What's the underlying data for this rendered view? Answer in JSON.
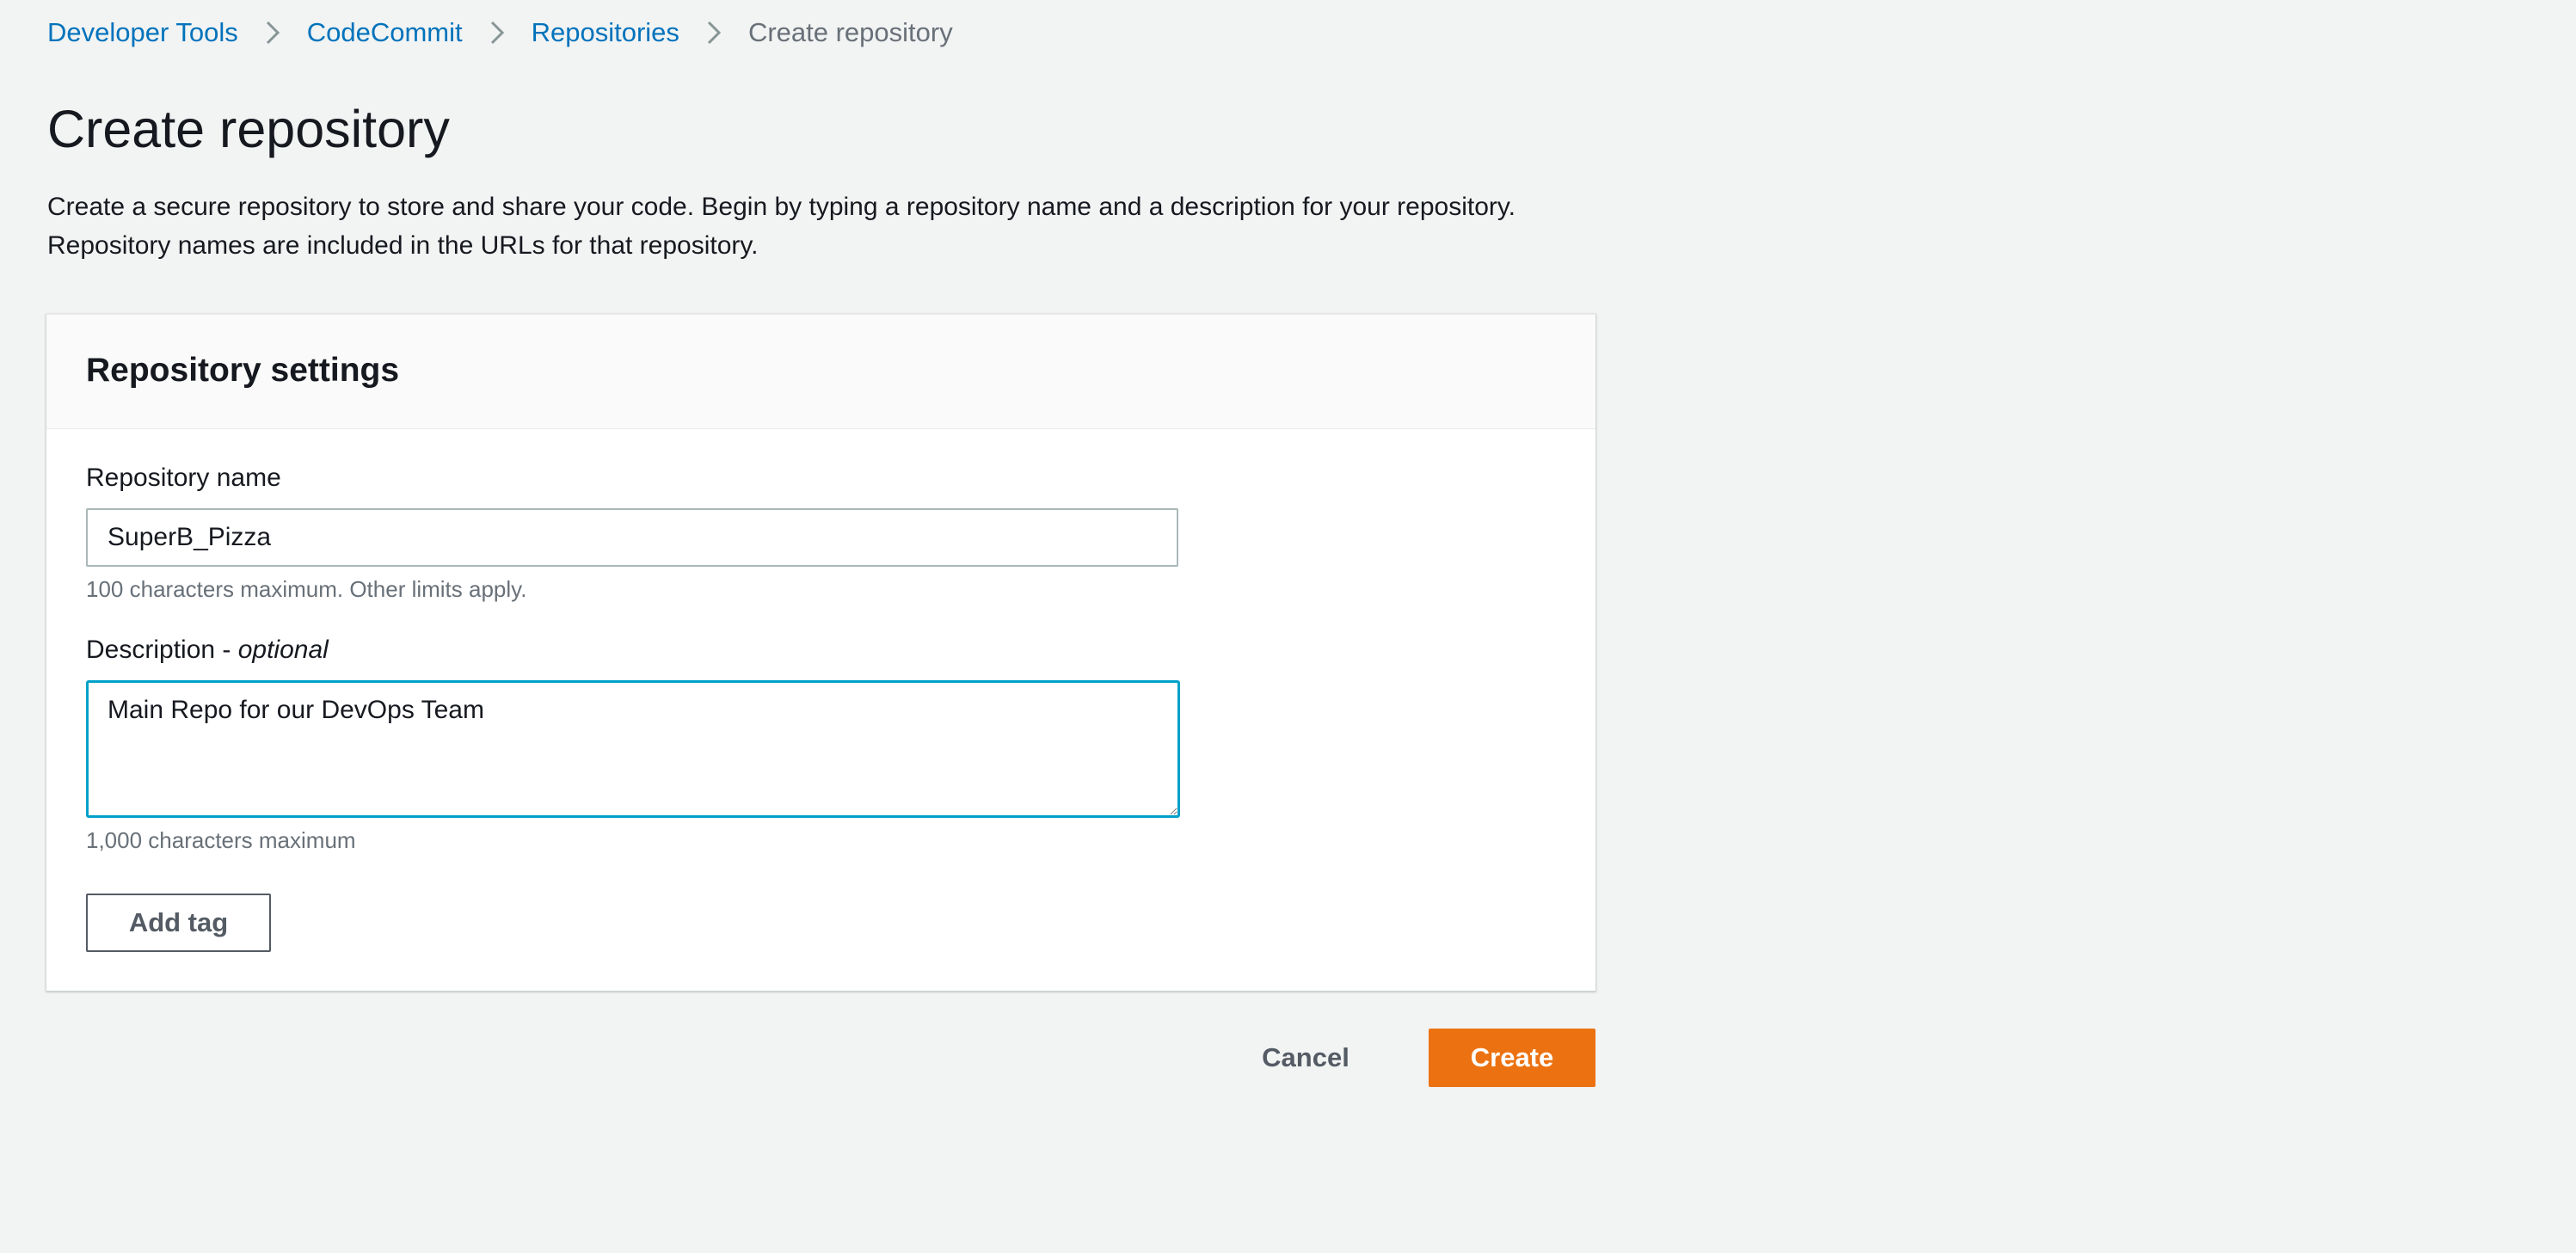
{
  "breadcrumb": {
    "items": [
      {
        "label": "Developer Tools"
      },
      {
        "label": "CodeCommit"
      },
      {
        "label": "Repositories"
      },
      {
        "label": "Create repository"
      }
    ],
    "separator_icon": "chevron-right-icon"
  },
  "page": {
    "title": "Create repository",
    "description": "Create a secure repository to store and share your code. Begin by typing a repository name and a description for your repository. Repository names are included in the URLs for that repository."
  },
  "settings": {
    "title": "Repository settings",
    "name": {
      "label": "Repository name",
      "value": "SuperB_Pizza",
      "hint": "100 characters maximum. Other limits apply."
    },
    "description": {
      "label": "Description - ",
      "optional_label": "optional",
      "value": "Main Repo for our DevOps Team",
      "hint": "1,000 characters maximum"
    },
    "add_tag_label": "Add tag"
  },
  "actions": {
    "cancel_label": "Cancel",
    "create_label": "Create"
  },
  "colors": {
    "link": "#0073bb",
    "primary": "#ec7211",
    "focus": "#00a1c9",
    "background": "#f2f3f3"
  }
}
